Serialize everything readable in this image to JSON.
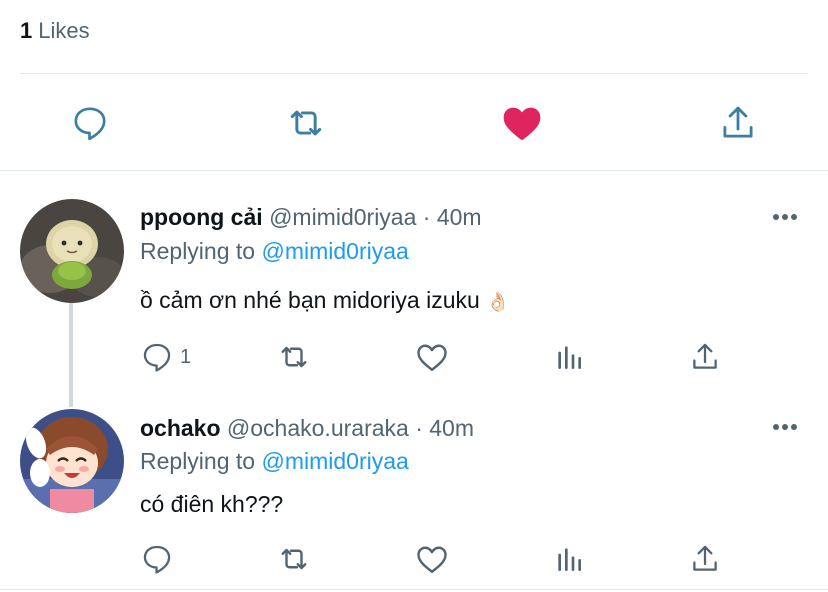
{
  "likes": {
    "count": "1",
    "label": "Likes"
  },
  "main_actions": {
    "reply_icon": "comment-icon",
    "retweet_icon": "retweet-icon",
    "like_icon": "heart-filled-icon",
    "share_icon": "share-icon",
    "like_color": "#e0245e",
    "icon_color": "#3b7ea1"
  },
  "replies": [
    {
      "display_name": "ppoong cải",
      "handle": "@mimid0riyaa",
      "separator": "·",
      "time": "40m",
      "replying_label": "Replying to",
      "replying_to": "@mimid0riyaa",
      "text": "ồ cảm ơn nhé bạn midoriya izuku",
      "emoji": "👌🏻",
      "reply_count": "1"
    },
    {
      "display_name": "ochako",
      "handle": "@ochako.uraraka",
      "separator": "·",
      "time": "40m",
      "replying_label": "Replying to",
      "replying_to": "@mimid0riyaa",
      "text": "có điên kh???",
      "reply_count": ""
    }
  ]
}
